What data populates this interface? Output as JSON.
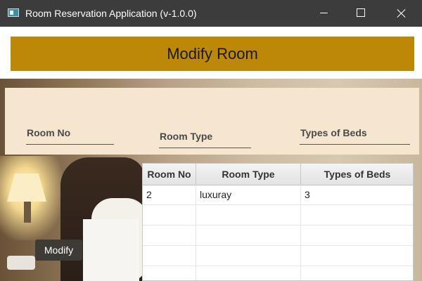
{
  "window": {
    "title": "Room Reservation Application (v-1.0.0)"
  },
  "header": {
    "title": "Modify Room"
  },
  "form": {
    "room_no_label": "Room No",
    "room_type_label": "Room Type",
    "types_of_beds_label": "Types of Beds"
  },
  "table": {
    "columns": [
      "Room No",
      "Room Type",
      "Types of Beds"
    ],
    "rows": [
      [
        "2",
        "luxuray",
        "3"
      ]
    ]
  },
  "buttons": {
    "modify_label": "Modify"
  },
  "colors": {
    "titlebar": "#3c3c3c",
    "header_banner": "#bd8808",
    "form_panel": "#f6e5cf",
    "modify_button": "#3e3a36"
  }
}
